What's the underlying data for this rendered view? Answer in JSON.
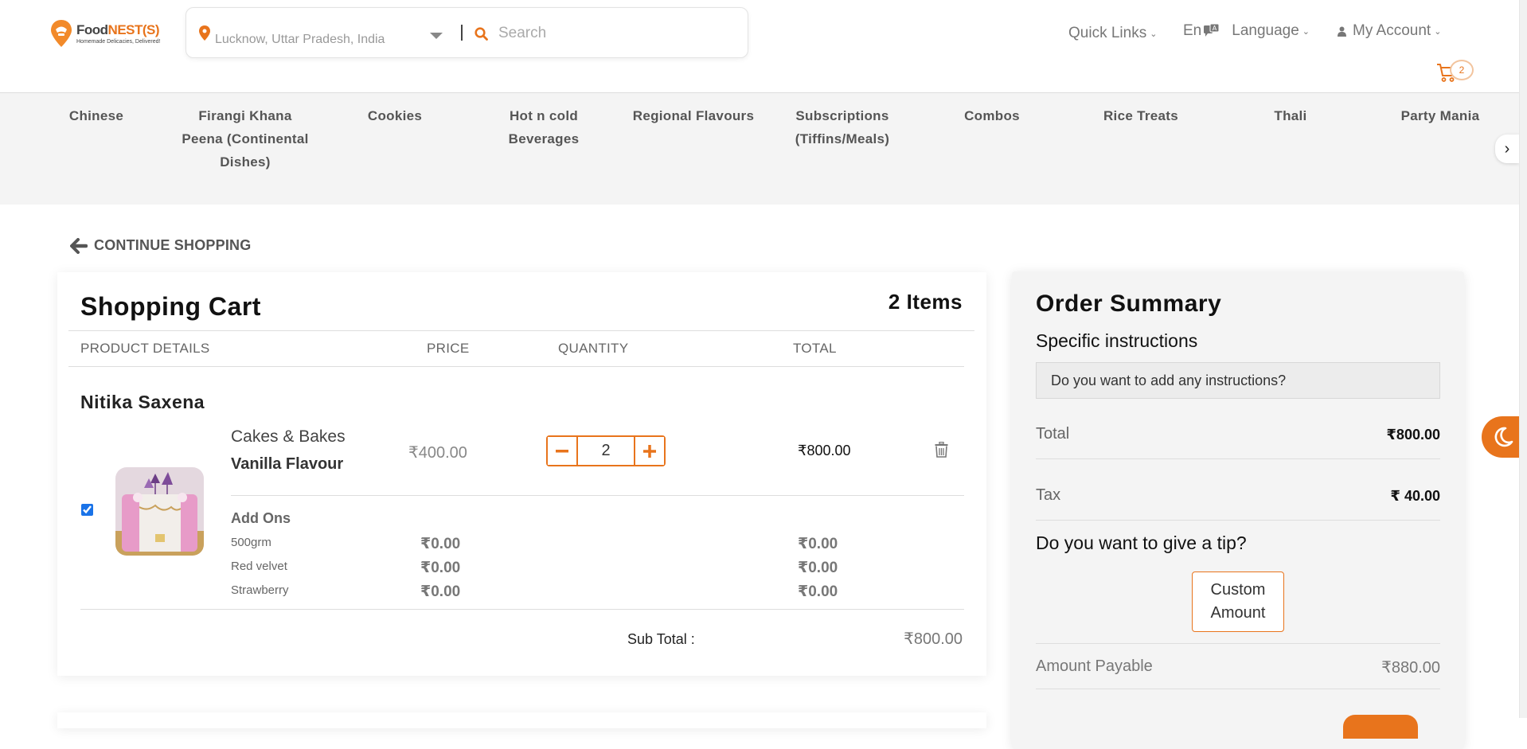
{
  "brand": {
    "name_part1": "Food",
    "name_part2": "NEST(S)",
    "tagline": "Homemade Delicacies, Delivered!"
  },
  "search": {
    "location": "Lucknow, Uttar Pradesh, India",
    "placeholder": "Search"
  },
  "header": {
    "quick_links": "Quick Links",
    "lang_code": "En",
    "language": "Language",
    "account": "My Account",
    "cart_count": "2"
  },
  "categories": [
    "Chinese",
    "Firangi Khana Peena (Continental Dishes)",
    "Cookies",
    "Hot n cold Beverages",
    "Regional Flavours",
    "Subscriptions (Tiffins/Meals)",
    "Combos",
    "Rice Treats",
    "Thali",
    "Party Mania"
  ],
  "continue_shopping": "CONTINUE SHOPPING",
  "cart": {
    "title": "Shopping Cart",
    "item_count": "2 Items",
    "columns": {
      "product": "PRODUCT DETAILS",
      "price": "PRICE",
      "quantity": "QUANTITY",
      "total": "TOTAL"
    },
    "vendor": "Nitika Saxena",
    "item": {
      "category": "Cakes & Bakes",
      "name": "Vanilla Flavour",
      "price": "₹400.00",
      "quantity": "2",
      "total": "₹800.00",
      "checked": true
    },
    "addons_label": "Add Ons",
    "addons": [
      {
        "name": "500grm",
        "price": "₹0.00",
        "total": "₹0.00"
      },
      {
        "name": "Red velvet",
        "price": "₹0.00",
        "total": "₹0.00"
      },
      {
        "name": "Strawberry",
        "price": "₹0.00",
        "total": "₹0.00"
      }
    ],
    "subtotal_label": "Sub Total :",
    "subtotal": "₹800.00"
  },
  "summary": {
    "title": "Order Summary",
    "instructions_title": "Specific instructions",
    "instructions_placeholder": "Do you want to add any instructions?",
    "total_label": "Total",
    "total_value": "₹800.00",
    "tax_label": "Tax",
    "tax_value": "₹ 40.00",
    "tip_question": "Do you want to give a tip?",
    "tip_button": "Custom Amount",
    "payable_label": "Amount Payable",
    "payable_value": "₹880.00"
  },
  "colors": {
    "accent": "#e8741c",
    "nav_bg": "#f4f4f4",
    "checkbox": "#1a73e8"
  },
  "icons": [
    "location-pin-icon",
    "chevron-down-icon",
    "search-icon",
    "translate-icon",
    "user-icon",
    "cart-icon",
    "chevron-right-icon",
    "arrow-left-icon",
    "minus-icon",
    "plus-icon",
    "trash-icon",
    "moon-icon"
  ]
}
